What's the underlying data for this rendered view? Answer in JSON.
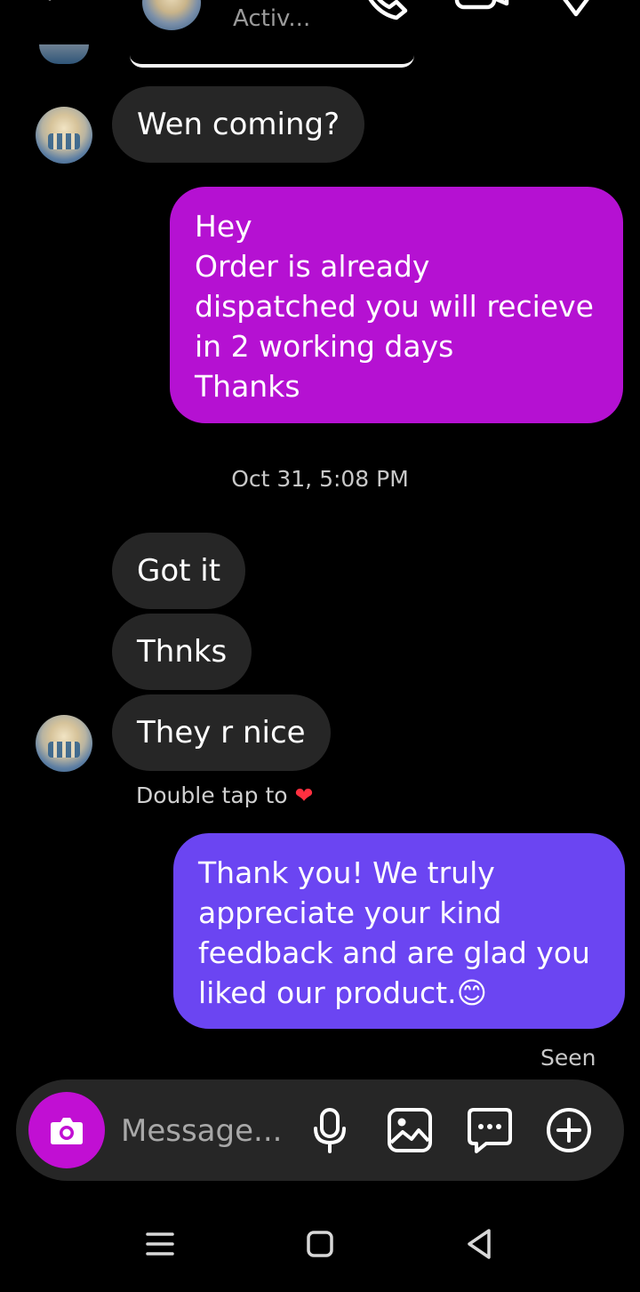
{
  "header": {
    "status": "Activ...",
    "icons": [
      "back-arrow-icon",
      "phone-icon",
      "video-icon",
      "tag-icon"
    ]
  },
  "messages": [
    {
      "side": "in",
      "text": "Wen coming?"
    },
    {
      "side": "out",
      "lines": [
        "Hey",
        "Order is already",
        "dispatched you will recieve",
        "in 2 working days",
        "Thanks"
      ],
      "color": "#b511d2"
    },
    {
      "side": "in",
      "text": "Got it"
    },
    {
      "side": "in",
      "text": "Thnks"
    },
    {
      "side": "in",
      "text": "They r nice"
    },
    {
      "side": "out",
      "lines": [
        "Thank you! We truly",
        "appreciate your kind",
        "feedback and are glad you",
        "liked our product.😊"
      ],
      "color": "#6b45f2"
    }
  ],
  "timestamp": "Oct 31, 5:08 PM",
  "double_tap_hint": "Double tap to",
  "seen_label": "Seen",
  "composer": {
    "placeholder": "Message...",
    "icons": [
      "camera-icon",
      "microphone-icon",
      "gallery-icon",
      "sticker-icon",
      "add-icon"
    ]
  },
  "colors": {
    "background": "#000000",
    "incoming_bubble": "#262626",
    "outgoing_bubble_1": "#b511d2",
    "outgoing_bubble_2": "#6b45f2",
    "camera_button": "#c10fd3"
  },
  "navbar": {
    "icons": [
      "menu-icon",
      "home-icon",
      "back-icon"
    ]
  }
}
